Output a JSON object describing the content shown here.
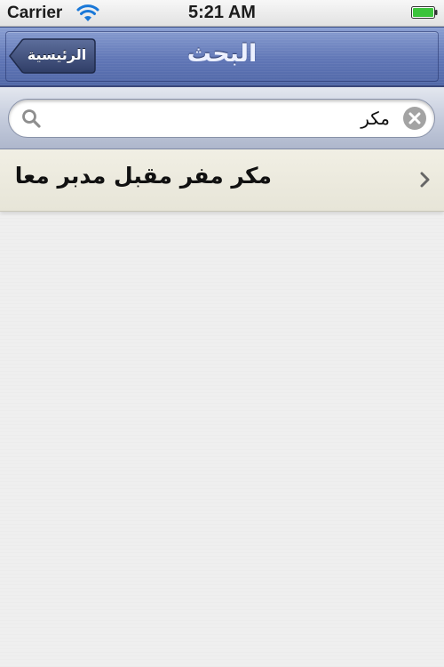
{
  "status_bar": {
    "carrier": "Carrier",
    "time": "5:21 AM",
    "wifi_icon": "wifi-icon",
    "battery_icon": "battery-icon"
  },
  "nav_bar": {
    "title": "البحث",
    "back_label": "الرئيسية"
  },
  "search": {
    "value": "مكر",
    "search_icon": "search-icon",
    "clear_icon": "clear-icon"
  },
  "results": [
    {
      "text": "مكر  مفر مقبل مدبر معا"
    }
  ],
  "colors": {
    "nav_bar": "#6076b6",
    "result_row": "#ecebdf",
    "background": "#efefef"
  }
}
